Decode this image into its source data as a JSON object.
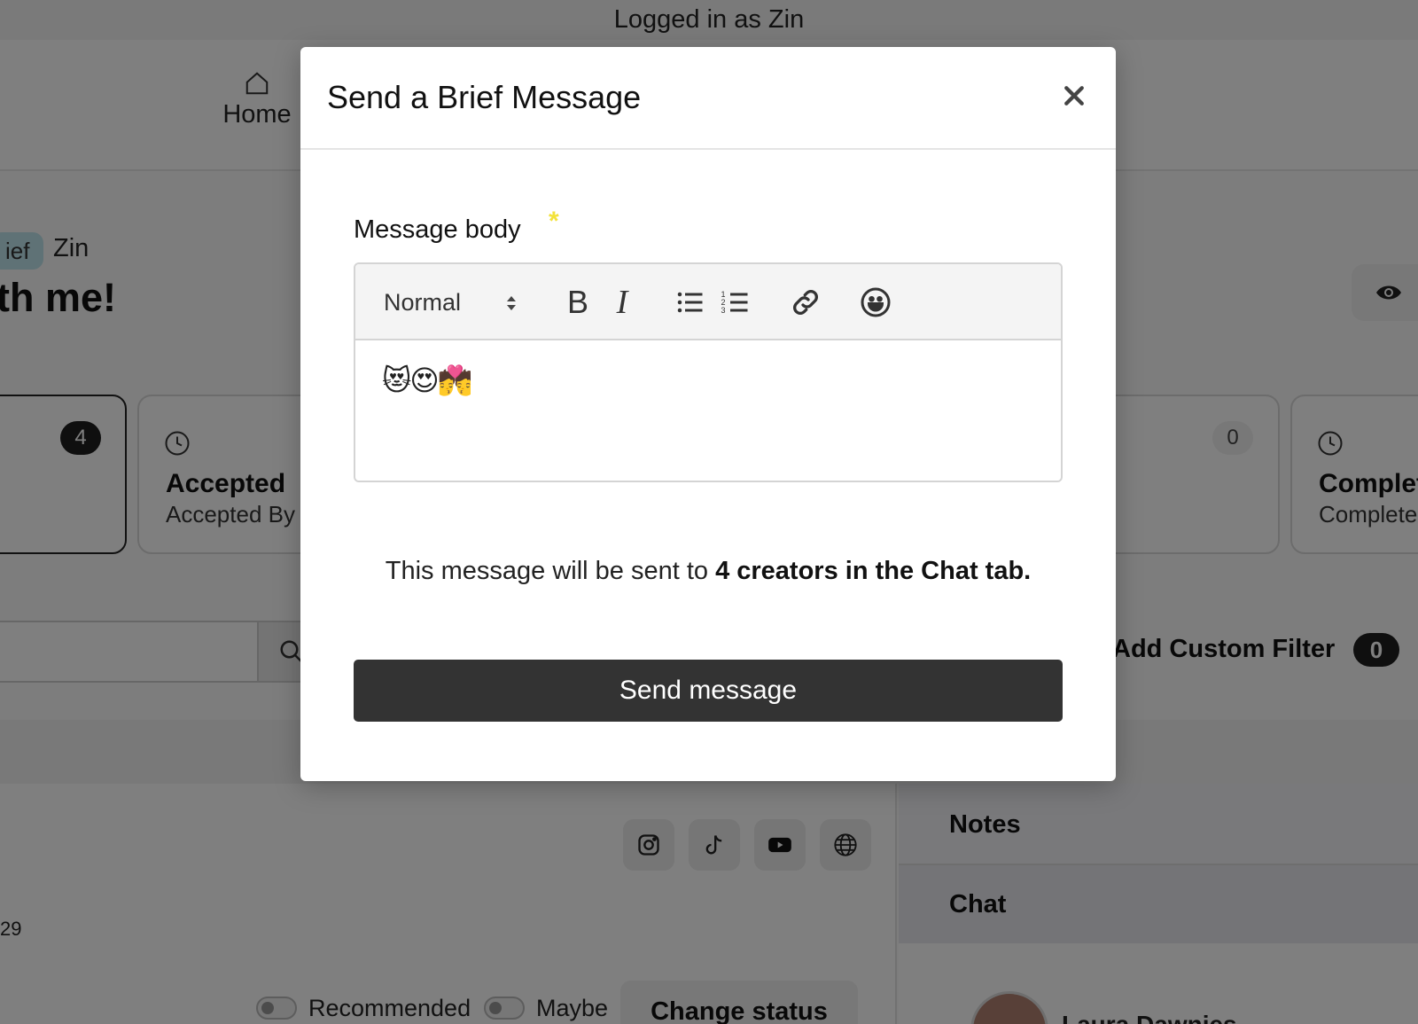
{
  "topbar": {
    "logged_in_text": "Logged in as Zin"
  },
  "nav": {
    "home_label": "Home"
  },
  "brief": {
    "type_chip": "ief",
    "owner": "Zin",
    "title_fragment": "th me!"
  },
  "stats": [
    {
      "count": "4",
      "name": "",
      "sub": ""
    },
    {
      "count": "",
      "name": "Accepted",
      "sub": "Accepted By"
    },
    {
      "count": "0",
      "name": "",
      "sub": ""
    },
    {
      "count": "",
      "name": "Complet",
      "sub": "Complete"
    }
  ],
  "filters": {
    "custom_filter_label": "Add Custom Filter",
    "custom_filter_count": "0"
  },
  "creator": {
    "partial_number": "29"
  },
  "toggles": {
    "recommended_label": "Recommended",
    "maybe_label": "Maybe"
  },
  "actions": {
    "change_status_label": "Change status"
  },
  "sidepanel": {
    "notes_label": "Notes",
    "chat_label": "Chat",
    "chat_contact_name": "Laura Dawnies"
  },
  "modal": {
    "title": "Send a Brief Message",
    "field_label": "Message body",
    "required_marker": "*",
    "editor": {
      "format_value": "Normal",
      "bold_label": "B",
      "italic_label": "I",
      "content": "😻😍💏"
    },
    "info_prefix": "This message will be sent to ",
    "info_bold": "4 creators in the Chat tab.",
    "send_label": "Send message"
  },
  "icons": [
    "home-icon",
    "clock-icon",
    "search-icon",
    "eye-icon",
    "instagram-icon",
    "tiktok-icon",
    "youtube-icon",
    "globe-icon",
    "close-icon",
    "select-arrows-icon",
    "bullet-list-icon",
    "numbered-list-icon",
    "link-icon",
    "emoji-icon"
  ]
}
